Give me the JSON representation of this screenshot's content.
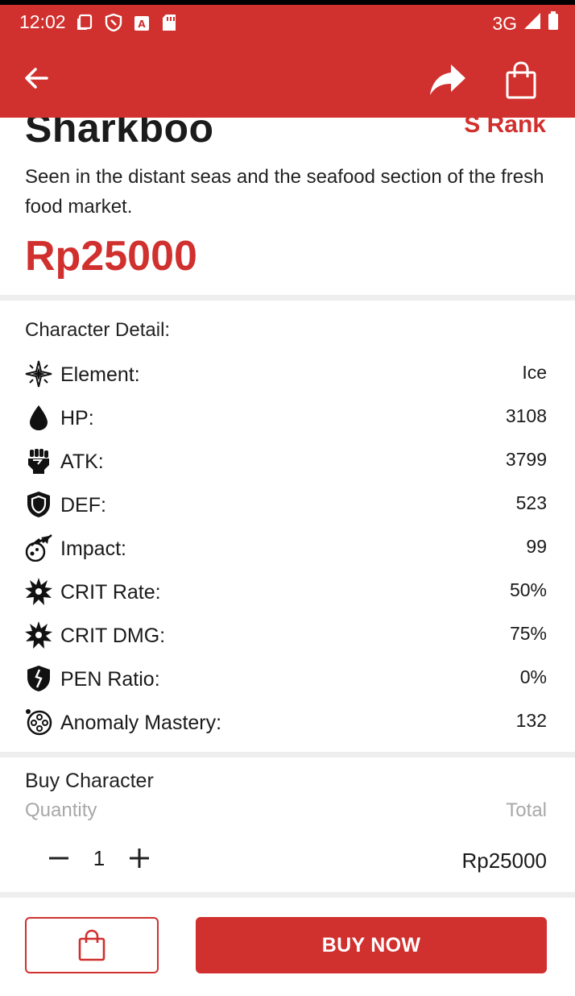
{
  "status_bar": {
    "time": "12:02",
    "network": "3G",
    "icons": [
      "screen-icon",
      "shield-icon",
      "a-badge-icon",
      "sd-card-icon",
      "signal-icon",
      "battery-icon"
    ]
  },
  "toolbar": {
    "back_icon": "arrow-left-icon",
    "share_icon": "share-icon",
    "cart_icon": "shopping-bag-icon"
  },
  "product": {
    "name": "Sharkboo",
    "rank": "S Rank",
    "description": "Seen in the distant seas and the seafood section of the fresh food market.",
    "price": "Rp25000"
  },
  "details": {
    "title": "Character Detail:",
    "stats": [
      {
        "label": "Element:",
        "value": "Ice",
        "icon": "element-icon"
      },
      {
        "label": "HP:",
        "value": "3108",
        "icon": "drop-icon"
      },
      {
        "label": "ATK:",
        "value": "3799",
        "icon": "fist-icon"
      },
      {
        "label": "DEF:",
        "value": "523",
        "icon": "shield-icon"
      },
      {
        "label": "Impact:",
        "value": "99",
        "icon": "impact-icon"
      },
      {
        "label": "CRIT Rate:",
        "value": "50%",
        "icon": "burst-icon"
      },
      {
        "label": "CRIT DMG:",
        "value": "75%",
        "icon": "burst-icon"
      },
      {
        "label": "PEN Ratio:",
        "value": "0%",
        "icon": "broken-shield-icon"
      },
      {
        "label": "Anomaly Mastery:",
        "value": "132",
        "icon": "anomaly-icon"
      }
    ]
  },
  "buy": {
    "title": "Buy Character",
    "quantity_label": "Quantity",
    "total_label": "Total",
    "quantity": "1",
    "total": "Rp25000"
  },
  "actions": {
    "buy_now": "BUY NOW"
  },
  "colors": {
    "brand": "#d0302e",
    "divider": "#eeeeee",
    "muted": "#a8a8a8"
  }
}
